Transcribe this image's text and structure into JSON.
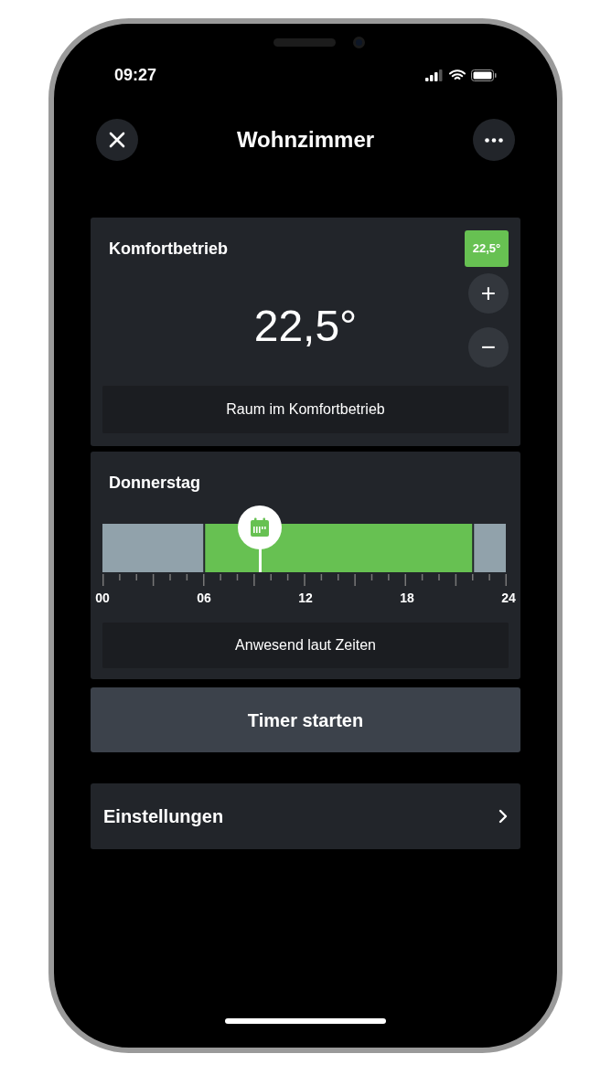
{
  "status_bar": {
    "time": "09:27"
  },
  "header": {
    "title": "Wohnzimmer"
  },
  "comfort_card": {
    "title": "Komfortbetrieb",
    "badge": "22,5°",
    "temperature": "22,5°",
    "plus": "+",
    "minus": "−",
    "status": "Raum im Komfortbetrieb"
  },
  "schedule_card": {
    "title": "Donnerstag",
    "chart_data": {
      "type": "bar",
      "orientation": "horizontal",
      "stacked": true,
      "xlim": [
        0,
        24
      ],
      "xticks": [
        {
          "value": 0,
          "label": "00"
        },
        {
          "value": 6,
          "label": "06"
        },
        {
          "value": 12,
          "label": "12"
        },
        {
          "value": 18,
          "label": "18"
        },
        {
          "value": 24,
          "label": "24"
        }
      ],
      "series": [
        {
          "color": "#91a2ab",
          "values": [
            6
          ]
        },
        {
          "color": "#67c152",
          "values": [
            16
          ]
        },
        {
          "color": "#91a2ab",
          "values": [
            2
          ]
        }
      ]
    },
    "marker": {
      "level": 0.39
    },
    "status": "Anwesend laut Zeiten"
  },
  "timer_button": "Timer starten",
  "settings_row": {
    "label": "Einstellungen"
  }
}
